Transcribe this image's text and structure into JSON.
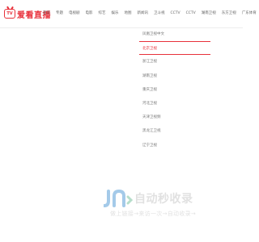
{
  "logo": {
    "tv_text": "TV",
    "text": "爱看直播"
  },
  "nav": {
    "items": [
      "首页",
      "专题",
      "电视剧",
      "电影",
      "综艺",
      "娱乐",
      "地图",
      "新闻讯",
      "卫斗视",
      "CCTV",
      "CCTV",
      "湖南卫视",
      "东方卫视",
      "广东体育"
    ]
  },
  "submenu": {
    "items": [
      "凤凰卫视中文",
      "北京卫视",
      "浙江卫视",
      "湖南卫视",
      "重庆卫视",
      "河北卫视",
      "天津卫视频",
      "黑龙江卫视",
      "辽宁卫视"
    ],
    "active_index": 1
  },
  "watermark": {
    "title": "自动秒收录",
    "subtitle": "做上链接→来访一次→自动收录→",
    "logo_text": "JN"
  },
  "colors": {
    "accent": "#e8303a",
    "watermark": "#c9c9c9"
  }
}
